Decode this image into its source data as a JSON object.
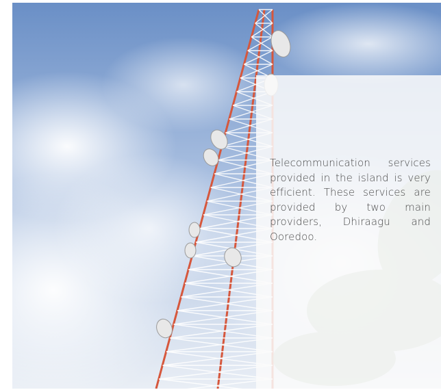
{
  "hero": {
    "description_icon": "telecom-tower-photo"
  },
  "caption": {
    "text": "Telecommunication services provided in the island is very efficient. These services are provided by two main providers, Dhiraagu and Ooredoo."
  },
  "colors": {
    "sky_top": "#6a8fc6",
    "sky_bottom": "#e6ecf4",
    "tower_red": "#d6573c",
    "tower_white": "#ffffff",
    "panel": "#f5f5f5",
    "text": "#4a4a4a"
  }
}
